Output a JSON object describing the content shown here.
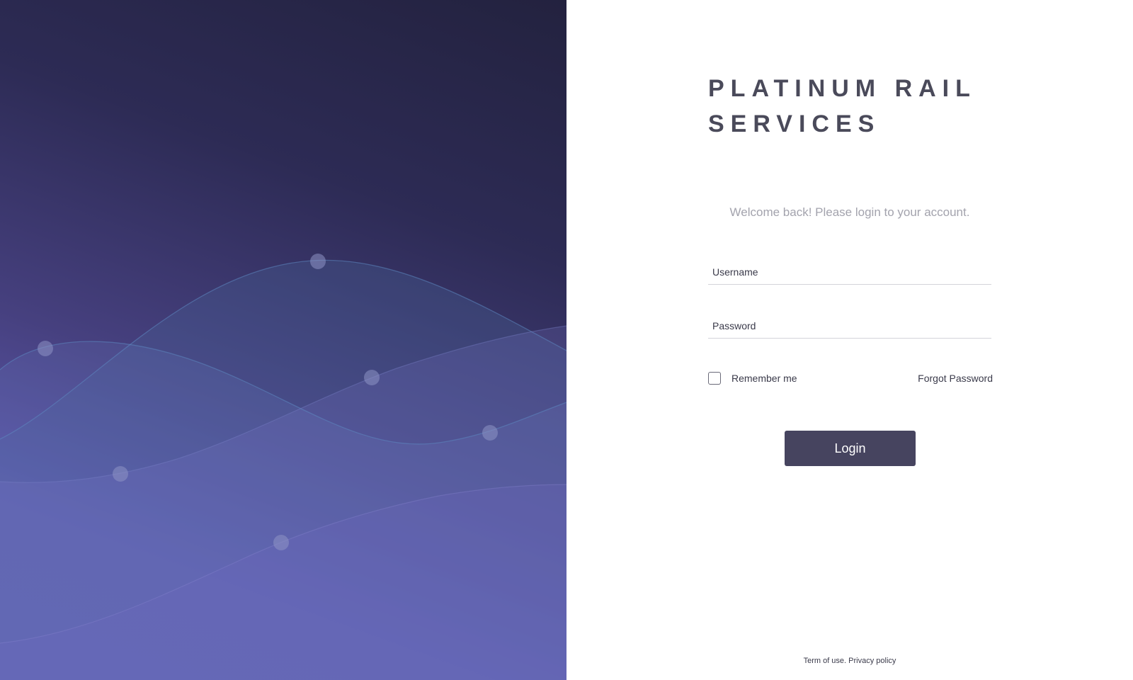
{
  "brand": {
    "line1": "PLATINUM RAIL",
    "line2": "SERVICES"
  },
  "welcome": "Welcome back! Please login to your account.",
  "username": {
    "placeholder": "Username",
    "value": ""
  },
  "password": {
    "placeholder": "Password",
    "value": ""
  },
  "remember": {
    "label": "Remember me",
    "checked": false
  },
  "forgot_password": "Forgot Password",
  "login_button": "Login",
  "footer": {
    "terms": "Term of use.",
    "privacy": "Privacy policy"
  },
  "colors": {
    "accent": "#46445f",
    "hero_dark": "#23223f",
    "hero_light": "#5f59b0",
    "title": "#4a4a5a",
    "muted": "#a3a3ad"
  }
}
